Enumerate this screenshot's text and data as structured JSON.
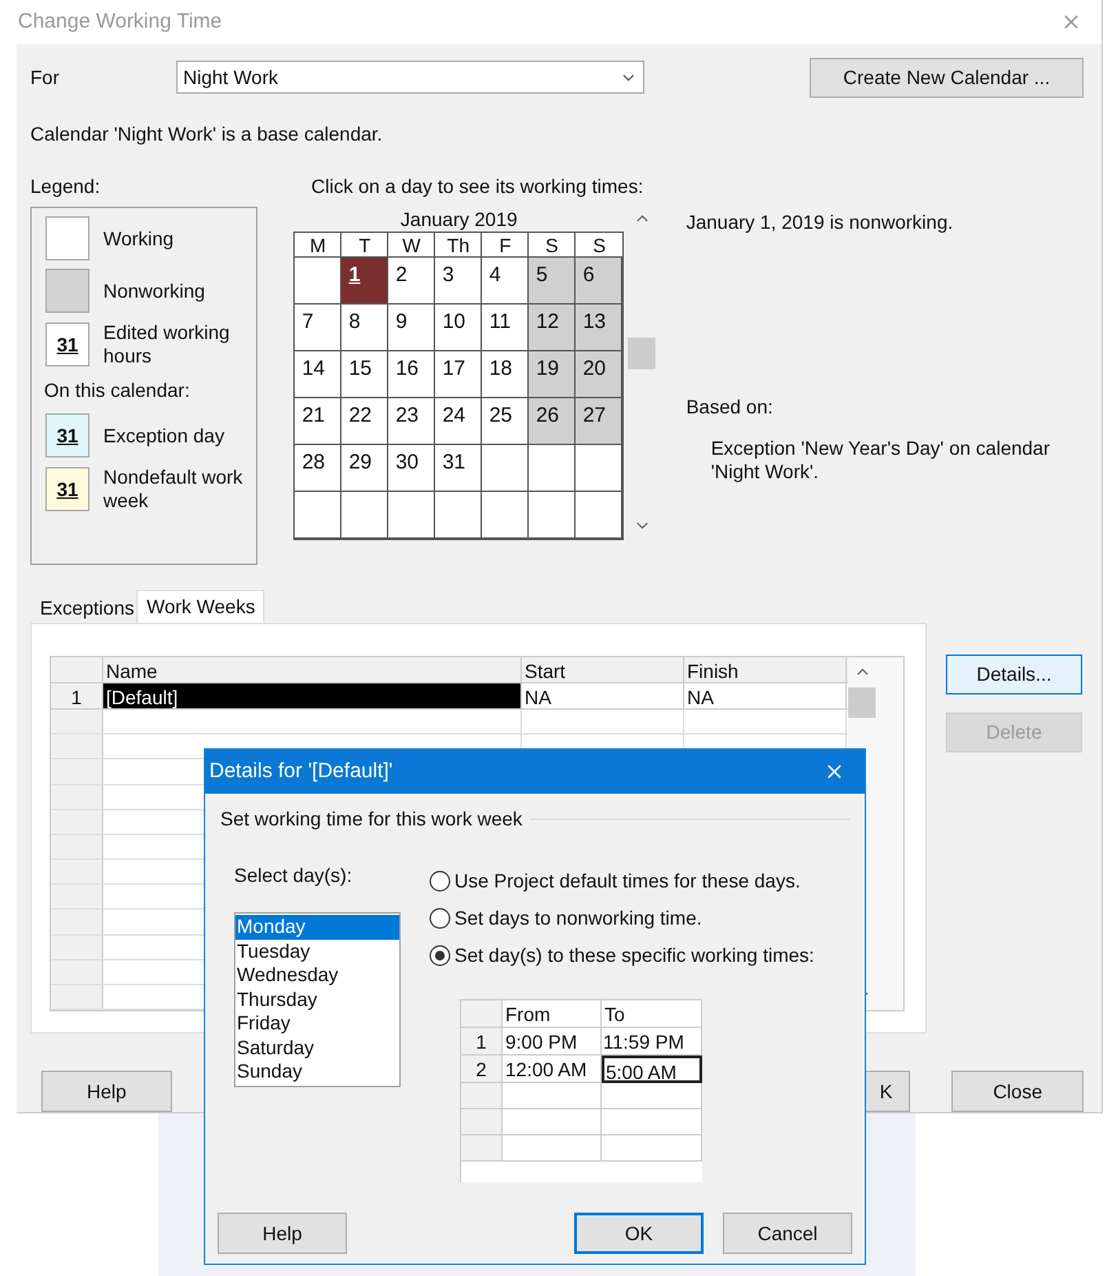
{
  "window": {
    "title": "Change Working Time"
  },
  "for": {
    "label": "For",
    "value": "Night Work"
  },
  "create_button": "Create New Calendar ...",
  "calendar_note": "Calendar 'Night Work' is a base calendar.",
  "legend": {
    "title": "Legend:",
    "items": [
      {
        "kind": "working",
        "label": "Working"
      },
      {
        "kind": "nonworking",
        "label": "Nonworking"
      },
      {
        "kind": "edited",
        "swatch": "31",
        "label": "Edited working hours"
      },
      {
        "kind": "heading",
        "label": "On this calendar:"
      },
      {
        "kind": "exception",
        "swatch": "31",
        "label": "Exception day"
      },
      {
        "kind": "nondefault",
        "swatch": "31",
        "label": "Nondefault work week"
      }
    ]
  },
  "calendar": {
    "prompt": "Click on a day to see its working times:",
    "month": "January 2019",
    "weekdays": [
      "M",
      "T",
      "W",
      "Th",
      "F",
      "S",
      "S"
    ],
    "weeks": [
      [
        {
          "nonworking": false,
          "selected": false
        },
        {
          "day": "1",
          "nonworking": true,
          "selected": true
        },
        {
          "day": "2",
          "nonworking": false,
          "selected": false
        },
        {
          "day": "3",
          "nonworking": false,
          "selected": false
        },
        {
          "day": "4",
          "nonworking": false,
          "selected": false
        },
        {
          "day": "5",
          "nonworking": true,
          "selected": false
        },
        {
          "day": "6",
          "nonworking": true,
          "selected": false
        }
      ],
      [
        {
          "day": "7",
          "nonworking": false,
          "selected": false
        },
        {
          "day": "8",
          "nonworking": false,
          "selected": false
        },
        {
          "day": "9",
          "nonworking": false,
          "selected": false
        },
        {
          "day": "10",
          "nonworking": false,
          "selected": false
        },
        {
          "day": "11",
          "nonworking": false,
          "selected": false
        },
        {
          "day": "12",
          "nonworking": true,
          "selected": false
        },
        {
          "day": "13",
          "nonworking": true,
          "selected": false
        }
      ],
      [
        {
          "day": "14",
          "nonworking": false,
          "selected": false
        },
        {
          "day": "15",
          "nonworking": false,
          "selected": false
        },
        {
          "day": "16",
          "nonworking": false,
          "selected": false
        },
        {
          "day": "17",
          "nonworking": false,
          "selected": false
        },
        {
          "day": "18",
          "nonworking": false,
          "selected": false
        },
        {
          "day": "19",
          "nonworking": true,
          "selected": false
        },
        {
          "day": "20",
          "nonworking": true,
          "selected": false
        }
      ],
      [
        {
          "day": "21",
          "nonworking": false,
          "selected": false
        },
        {
          "day": "22",
          "nonworking": false,
          "selected": false
        },
        {
          "day": "23",
          "nonworking": false,
          "selected": false
        },
        {
          "day": "24",
          "nonworking": false,
          "selected": false
        },
        {
          "day": "25",
          "nonworking": false,
          "selected": false
        },
        {
          "day": "26",
          "nonworking": true,
          "selected": false
        },
        {
          "day": "27",
          "nonworking": true,
          "selected": false
        }
      ],
      [
        {
          "day": "28",
          "nonworking": false,
          "selected": false
        },
        {
          "day": "29",
          "nonworking": false,
          "selected": false
        },
        {
          "day": "30",
          "nonworking": false,
          "selected": false
        },
        {
          "day": "31",
          "nonworking": false,
          "selected": false
        },
        {
          "nonworking": false,
          "selected": false
        },
        {
          "nonworking": false,
          "selected": false
        },
        {
          "nonworking": false,
          "selected": false
        }
      ],
      [
        {
          "nonworking": false,
          "selected": false
        },
        {
          "nonworking": false,
          "selected": false
        },
        {
          "nonworking": false,
          "selected": false
        },
        {
          "nonworking": false,
          "selected": false
        },
        {
          "nonworking": false,
          "selected": false
        },
        {
          "nonworking": false,
          "selected": false
        },
        {
          "nonworking": false,
          "selected": false
        }
      ]
    ]
  },
  "day_info": {
    "status": "January 1, 2019 is nonworking.",
    "based_on_label": "Based on:",
    "based_on": "Exception 'New Year's Day' on calendar 'Night Work'."
  },
  "tabs": [
    {
      "label": "Exceptions",
      "selected": false
    },
    {
      "label": "Work Weeks",
      "selected": true
    }
  ],
  "work_weeks": {
    "columns": [
      "Name",
      "Start",
      "Finish"
    ],
    "rows": [
      {
        "num": "1",
        "name": "[Default]",
        "start": "NA",
        "finish": "NA",
        "selected": true
      }
    ]
  },
  "side_buttons": [
    {
      "label": "Details...",
      "disabled": false
    },
    {
      "label": "Delete",
      "disabled": true
    }
  ],
  "footer_buttons": [
    {
      "label": "Help"
    },
    {
      "label": "K"
    },
    {
      "label": "Close"
    }
  ],
  "details_dialog": {
    "title": "Details for '[Default]'",
    "section": "Set working time for this work week",
    "select_label": "Select day(s):",
    "days": [
      {
        "label": "Monday",
        "selected": true
      },
      {
        "label": "Tuesday",
        "selected": false
      },
      {
        "label": "Wednesday",
        "selected": false
      },
      {
        "label": "Thursday",
        "selected": false
      },
      {
        "label": "Friday",
        "selected": false
      },
      {
        "label": "Saturday",
        "selected": false
      },
      {
        "label": "Sunday",
        "selected": false
      }
    ],
    "options": [
      {
        "label": "Use Project default times for these days.",
        "selected": false
      },
      {
        "label": "Set days to nonworking time.",
        "selected": false
      },
      {
        "label": "Set day(s) to these specific working times:",
        "selected": true
      }
    ],
    "times": {
      "columns": [
        "From",
        "To"
      ],
      "rows": [
        {
          "num": "1",
          "from": "9:00 PM",
          "to": "11:59 PM",
          "focused": false
        },
        {
          "num": "2",
          "from": "12:00 AM",
          "to": "5:00 AM",
          "focused": true
        }
      ]
    },
    "buttons": [
      {
        "label": "Help",
        "default": false
      },
      {
        "label": "OK",
        "default": true
      },
      {
        "label": "Cancel",
        "default": false
      }
    ]
  }
}
